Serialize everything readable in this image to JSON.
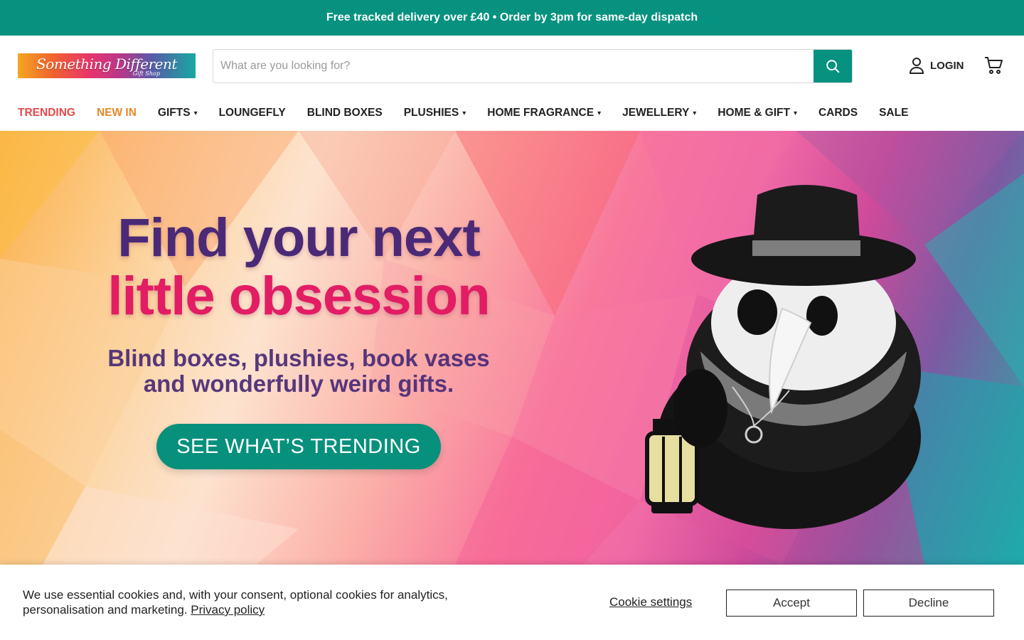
{
  "announcement": "Free tracked delivery over £40 • Order by 3pm for same-day dispatch",
  "header": {
    "logo_main": "Something Different",
    "logo_sub": "Gift Shop",
    "search_placeholder": "What are you looking for?",
    "search_value": "",
    "login_label": "LOGIN",
    "icons": {
      "search": "search-icon",
      "user": "user-icon",
      "cart": "cart-icon"
    }
  },
  "nav": {
    "items": [
      {
        "label": "TRENDING",
        "dropdown": false
      },
      {
        "label": "NEW IN",
        "dropdown": false
      },
      {
        "label": "GIFTS",
        "dropdown": true
      },
      {
        "label": "LOUNGEFLY",
        "dropdown": false
      },
      {
        "label": "BLIND BOXES",
        "dropdown": false
      },
      {
        "label": "PLUSHIES",
        "dropdown": true
      },
      {
        "label": "HOME FRAGRANCE",
        "dropdown": true
      },
      {
        "label": "JEWELLERY",
        "dropdown": true
      },
      {
        "label": "HOME & GIFT",
        "dropdown": true
      },
      {
        "label": "CARDS",
        "dropdown": false
      },
      {
        "label": "SALE",
        "dropdown": false
      }
    ],
    "chevron": "⌄"
  },
  "hero": {
    "headline_line1": "Find your next",
    "headline_line2": "little obsession",
    "subline1": "Blind boxes, plushies, book vases",
    "subline2": "and wonderfully weird gifts.",
    "cta": "SEE WHAT’S TRENDING"
  },
  "cookie": {
    "text": "We use essential cookies and, with your consent, optional cookies for analytics, personalisation and marketing.",
    "privacy_link": "Privacy policy",
    "settings": "Cookie settings",
    "accept": "Accept",
    "decline": "Decline"
  },
  "colors": {
    "brand": "#06927f",
    "headline_purple": "#4a2a76",
    "headline_pink": "#e21d64",
    "trending": "#e24a4a",
    "new_in": "#e8872b"
  }
}
